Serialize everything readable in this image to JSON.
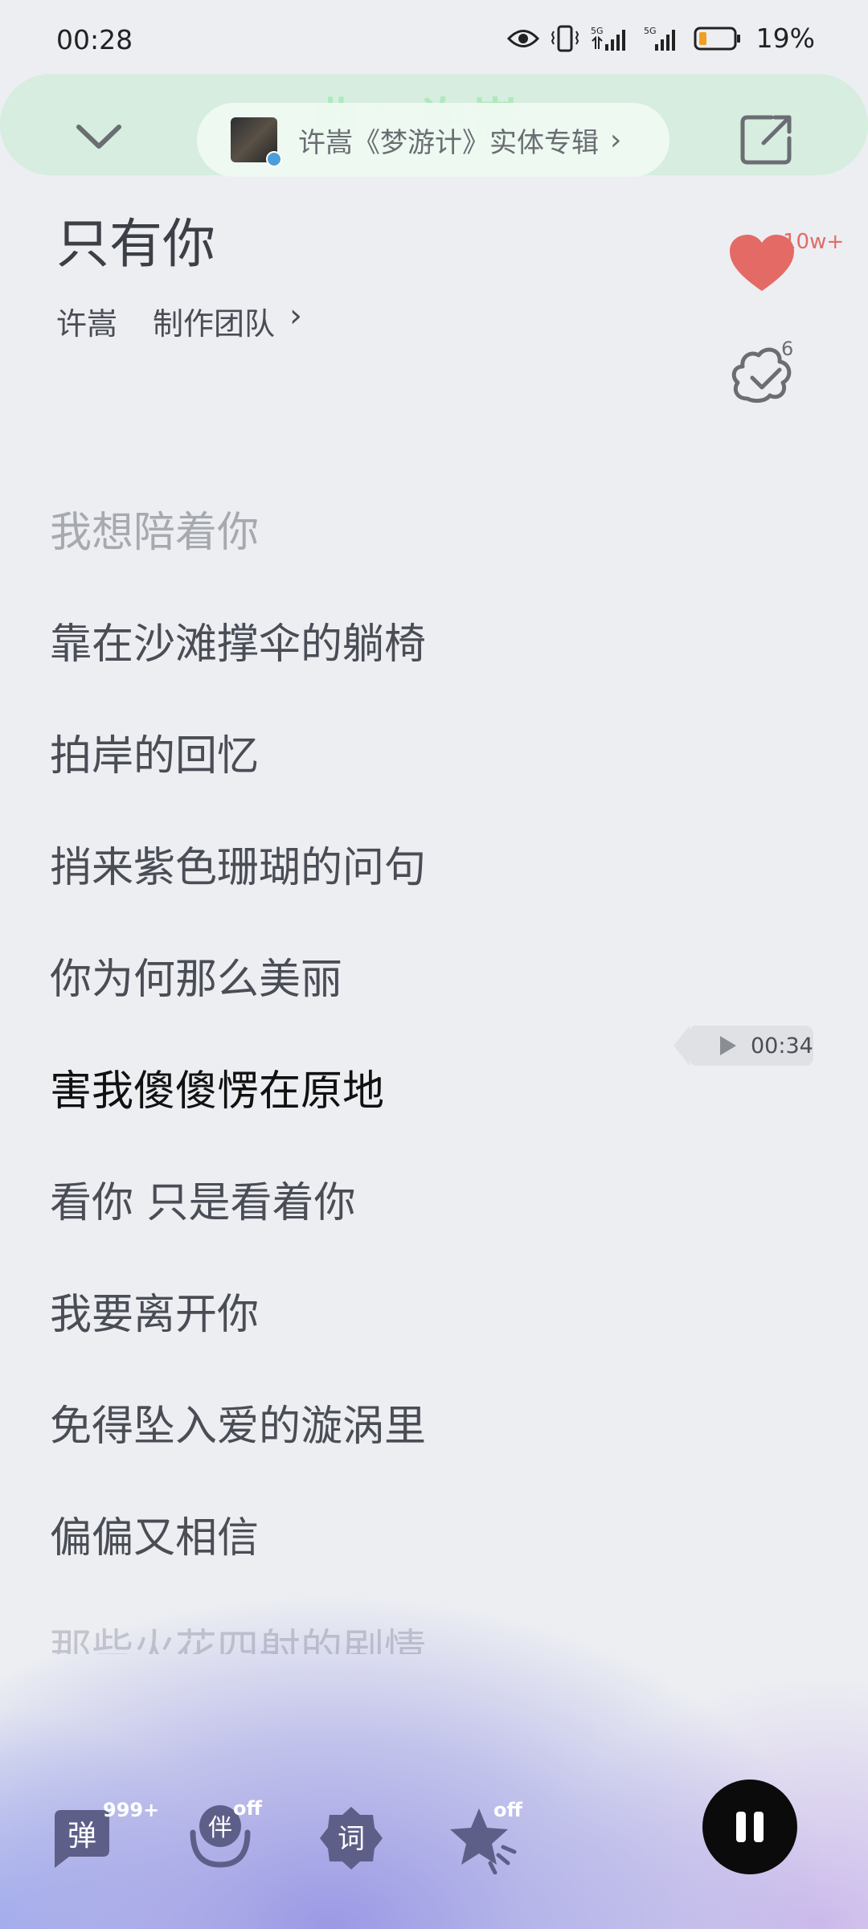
{
  "status": {
    "time": "00:28",
    "battery": "19%",
    "network1": "5G",
    "network2": "5G"
  },
  "header": {
    "watermark": "曲：许嵩",
    "album_text": "许嵩《梦游计》实体专辑",
    "album_chevron": "›"
  },
  "song": {
    "title": "只有你",
    "artist": "许嵩",
    "team": "制作团队",
    "team_chevron": "›",
    "like_count": "10w+",
    "comment_count": "6"
  },
  "lyrics": [
    {
      "text": "我想陪着你",
      "state": "past"
    },
    {
      "text": "靠在沙滩撑伞的躺椅",
      "state": "normal"
    },
    {
      "text": "拍岸的回忆",
      "state": "normal"
    },
    {
      "text": "捎来紫色珊瑚的问句",
      "state": "normal"
    },
    {
      "text": "你为何那么美丽",
      "state": "normal"
    },
    {
      "text": "害我傻傻愣在原地",
      "state": "current"
    },
    {
      "text": "看你 只是看着你",
      "state": "normal"
    },
    {
      "text": "我要离开你",
      "state": "normal"
    },
    {
      "text": "免得坠入爱的漩涡里",
      "state": "normal"
    },
    {
      "text": "偏偏又相信",
      "state": "normal"
    },
    {
      "text": "那些火花四射的剧情",
      "state": "faded"
    }
  ],
  "seek": {
    "time": "00:34"
  },
  "controls": {
    "danmu_label": "弹",
    "danmu_count": "999+",
    "accompany_label": "伴",
    "accompany_state": "off",
    "lyrics_label": "词",
    "effect_state": "off"
  },
  "colors": {
    "accent_like": "#e46a66",
    "bottom_glow": "#9a98e0"
  }
}
